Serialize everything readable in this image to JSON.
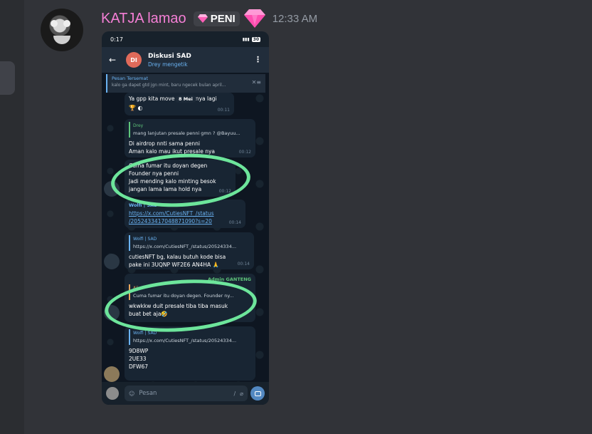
{
  "message": {
    "author": "KATJA lamao",
    "role": "PENI",
    "time": "12:33 AM"
  },
  "phone": {
    "status_time": "0:17",
    "battery": "30",
    "group_avatar": "DI",
    "group_name": "Diskusi SAD",
    "typing": "Drey mengetik",
    "pinned_title": "Pesan Tersemat",
    "pinned_text": "kalo ga dapet gtd jgn mint, baru ngecek bulan april...",
    "date_pill": "8 Mei",
    "messages": [
      {
        "text": "Ya gpp kita move ke lain nya lagi",
        "time": "00:11"
      },
      {
        "reply_name": "Drey",
        "reply_text": "mang lanjutan presale penni gmn ? @Bayuu...",
        "text1": "Di airdrop nnti sama penni",
        "text2": "Aman kalo mau ikut presale nya",
        "time": "00:12"
      },
      {
        "line1": "Cuma fumar itu doyan degen",
        "line2": "Founder nya penni",
        "line3": "Jadi mending kalo minting besok",
        "line4": "jangan lama lama hold nya",
        "time": "00:12"
      },
      {
        "sender": "Wolfi | SAD",
        "link1": "https://x.com/CutiesNFT_/status",
        "link2": "/2052433417048871090?s=20",
        "time": "00:14"
      },
      {
        "reply_name": "Wolfi | SAD",
        "reply_text": "https://x.com/CutiesNFT_/status/20524334...",
        "text1": "cutiesNFT bg, kalau butuh kode bisa",
        "text2": "pake ini 3UQNP WF2E6 AN4HA 🙏",
        "time": "00:14"
      },
      {
        "sender": "Admin GANTENG",
        "reply_name": "Aji",
        "reply_text": "Cuma fumar itu doyan degen. Founder ny...",
        "text1": "wkwkkw duit presale tiba tiba masuk",
        "text2": "buat bet aja🤣"
      },
      {
        "reply_name": "Wolfi | SAD",
        "reply_text": "https://x.com/CutiesNFT_/status/20524334...",
        "code1": "9D8WP",
        "code2": "2UE33",
        "code3": "DFW67"
      }
    ],
    "input_placeholder": "Pesan"
  },
  "colors": {
    "username": "#f47fd5",
    "circle": "#6de59b",
    "link": "#6ab2f2"
  }
}
